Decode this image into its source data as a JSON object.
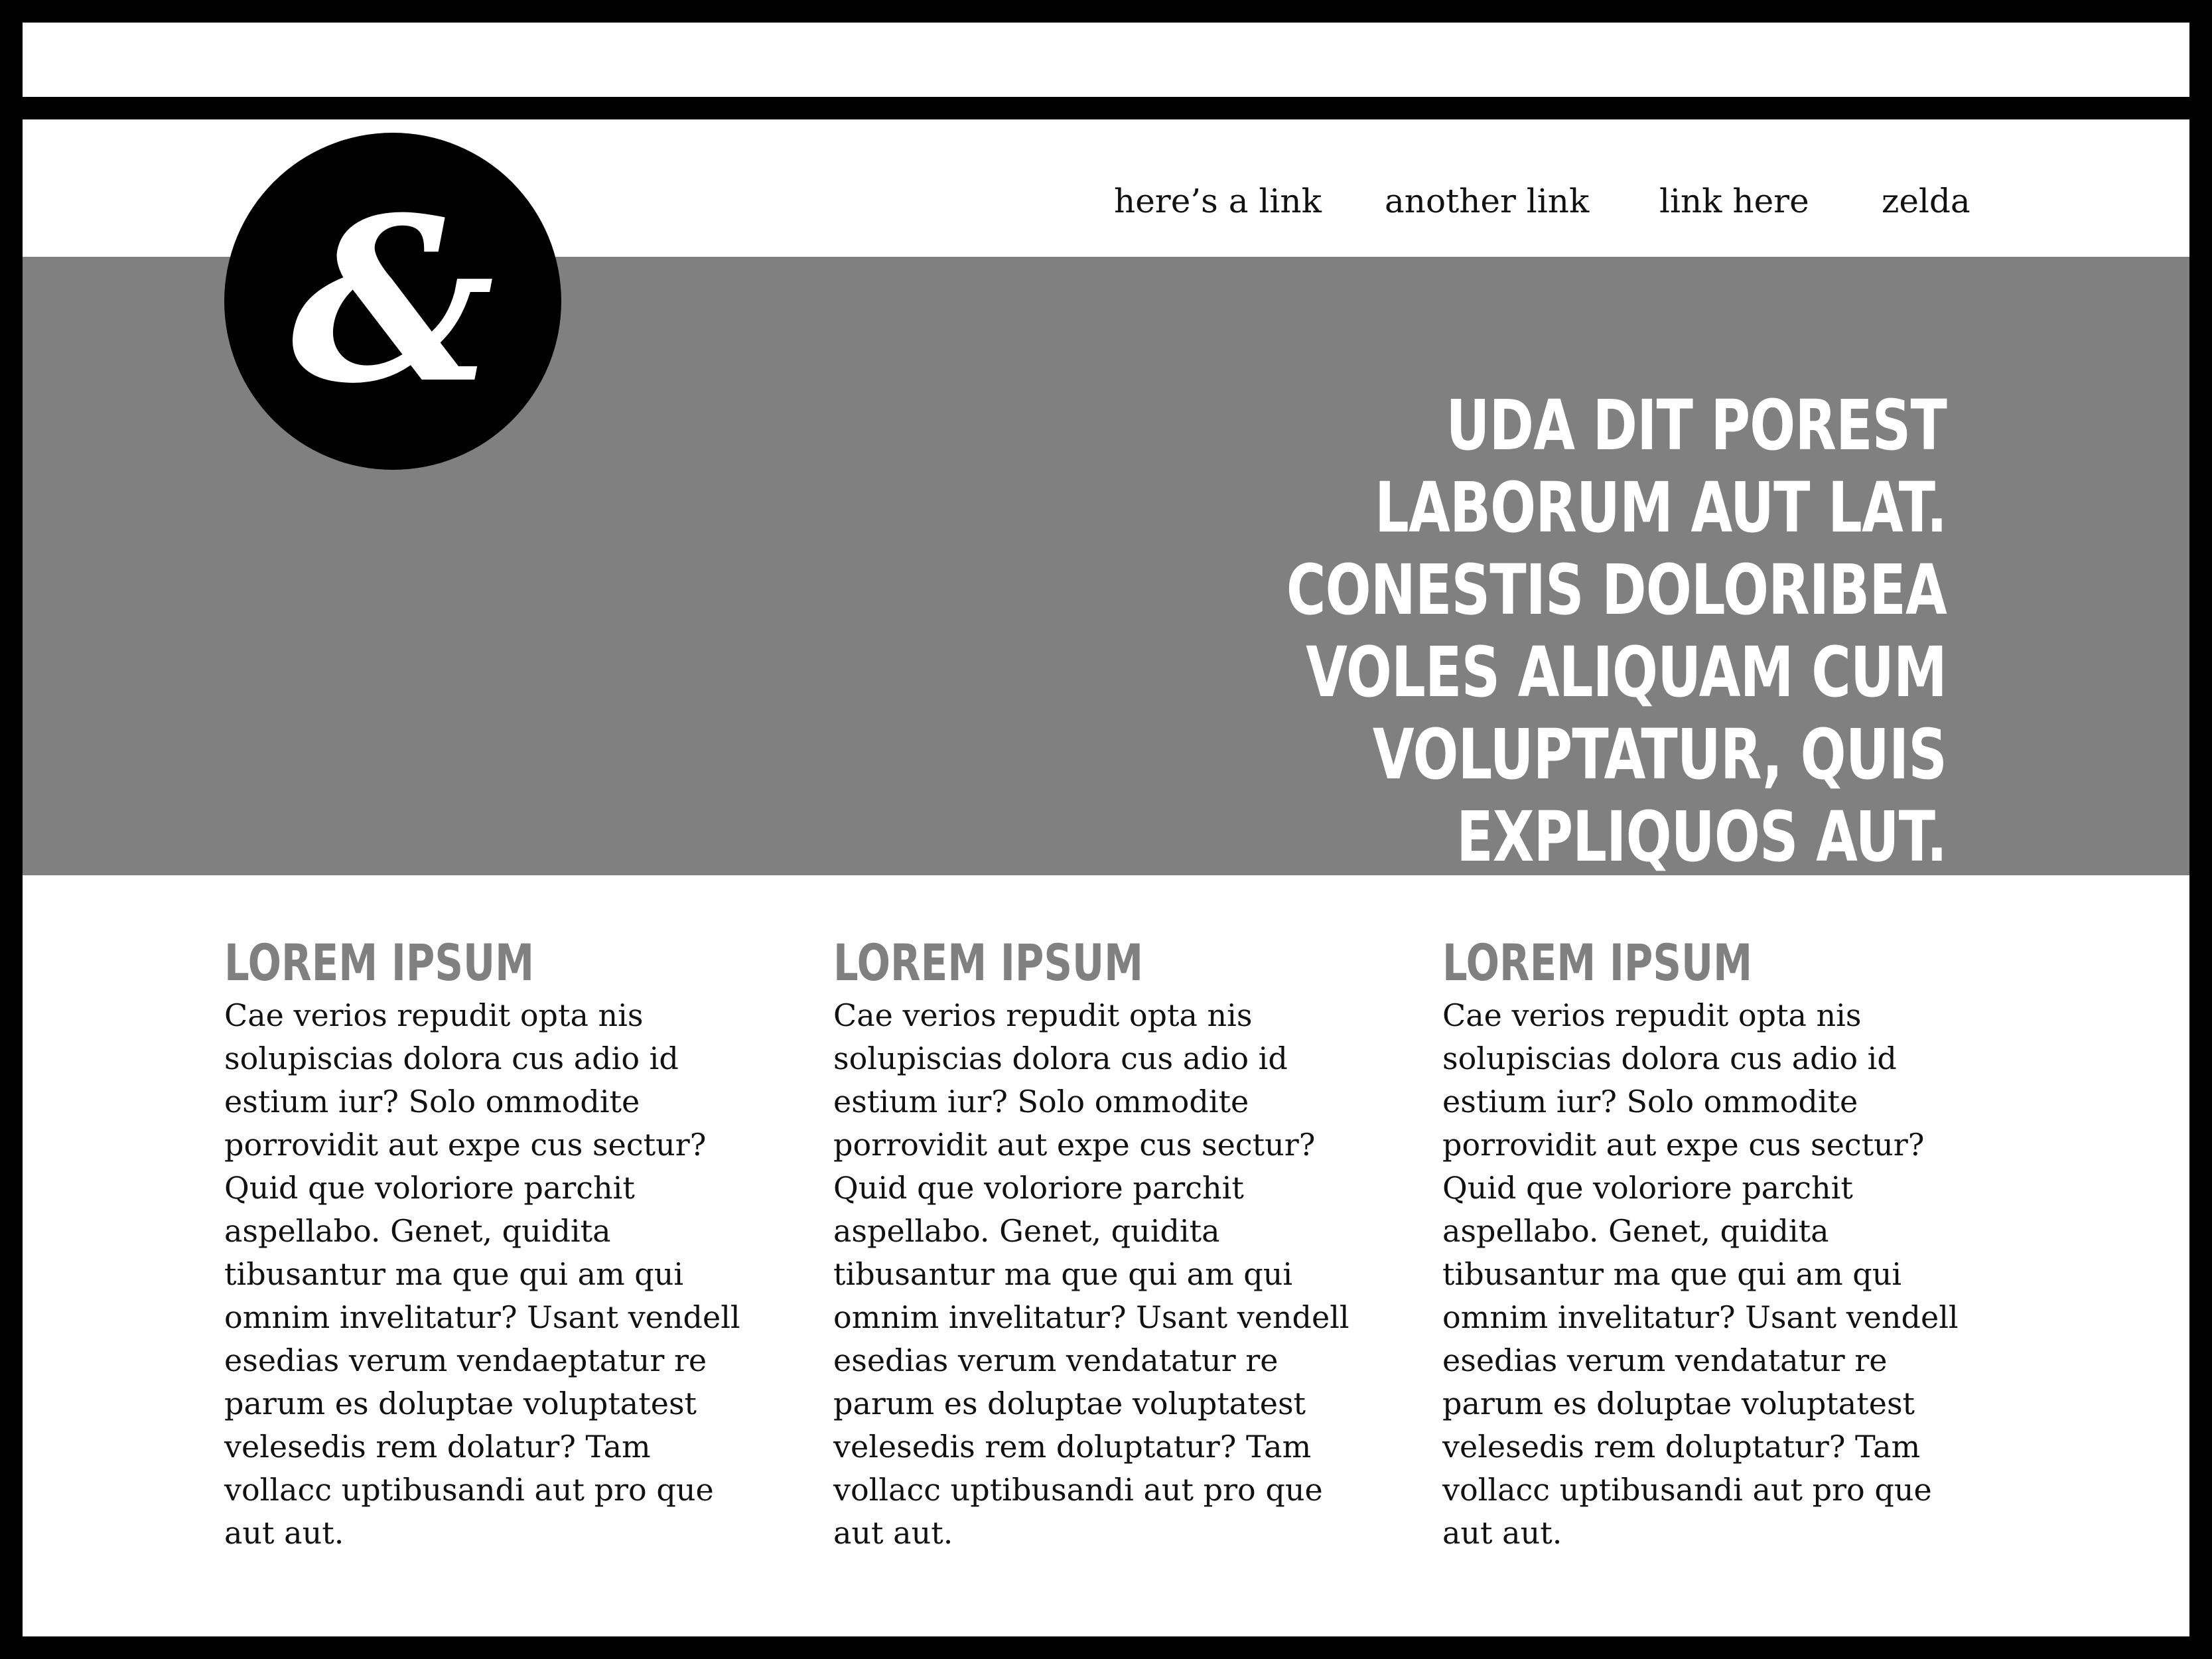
{
  "nav": {
    "links": [
      {
        "label": "here’s a link"
      },
      {
        "label": "another link"
      },
      {
        "label": "link here"
      },
      {
        "label": "zelda"
      }
    ]
  },
  "logo": {
    "glyph": "&",
    "icon": "ampersand-logo-icon"
  },
  "hero": {
    "headline": "UDA DIT POREST LABORUM AUT LAT. CONESTIS DOLORIBEA VOLES ALIQUAM CUM VOLUPTATUR, QUIS EXPLIQUOS AUT."
  },
  "columns": [
    {
      "title": "LOREM IPSUM",
      "body": "Cae verios repudit opta nis solupiscias dolora cus adio id estium iur? Solo ommodite porrovidit aut expe cus sectur? Quid que voloriore parchit aspellabo. Genet, quidita tibusantur ma que qui am qui omnim invelitatur? Usant vendell esedias verum vendaeptatur re parum es doluptae voluptatest velesedis rem dolatur? Tam vollacc uptibusandi aut pro que aut aut."
    },
    {
      "title": "LOREM IPSUM",
      "body": "Cae verios repudit opta nis solupiscias dolora cus adio id estium iur? Solo ommodite porrovidit aut expe cus sectur? Quid que voloriore parchit aspellabo. Genet, quidita tibusantur ma que qui am qui omnim invelitatur? Usant vendell esedias verum vendatatur re parum es doluptae voluptatest velesedis rem doluptatur? Tam vollacc uptibusandi aut pro que aut aut."
    },
    {
      "title": "LOREM IPSUM",
      "body": "Cae verios repudit opta nis solupiscias dolora cus adio id estium iur? Solo ommodite porrovidit aut expe cus sectur? Quid que voloriore parchit aspellabo. Genet, quidita tibusantur ma que qui am qui omnim invelitatur? Usant vendell esedias verum vendatatur re parum es doluptae voluptatest velesedis rem doluptatur? Tam vollacc uptibusandi aut pro que aut aut."
    }
  ],
  "colors": {
    "frame": "#000000",
    "hero_background": "#808080",
    "hero_text": "#ffffff",
    "column_title": "#808080",
    "body_text": "#111111"
  }
}
